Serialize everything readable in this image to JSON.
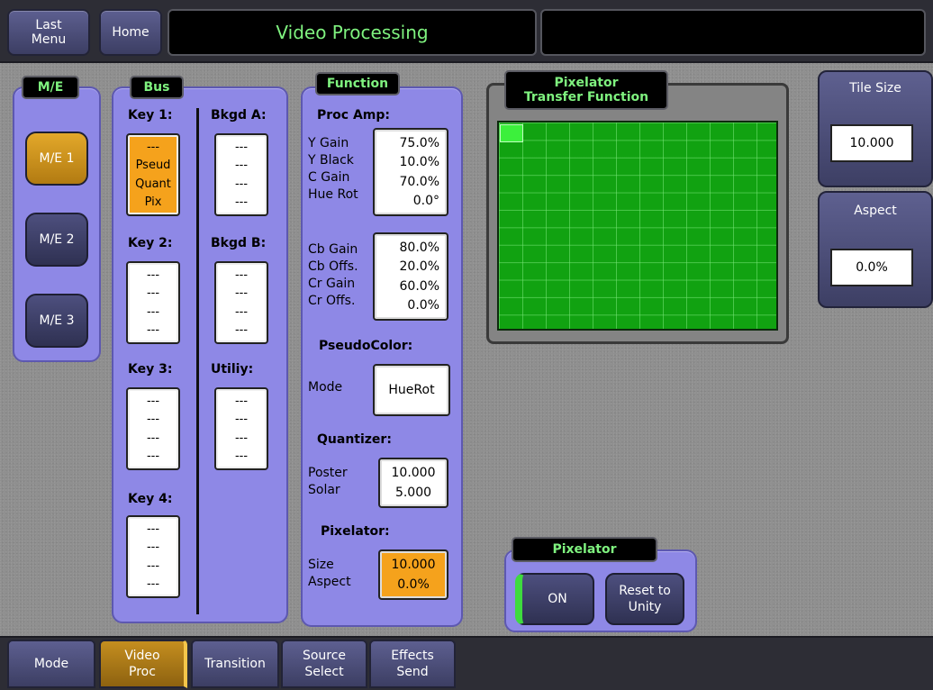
{
  "header": {
    "last_menu": "Last\nMenu",
    "home": "Home",
    "title": "Video Processing",
    "right_box": ""
  },
  "me": {
    "tag": "M/E",
    "buttons": [
      "M/E 1",
      "M/E 2",
      "M/E 3"
    ],
    "active": "M/E 1"
  },
  "bus": {
    "tag": "Bus",
    "key1": {
      "label": "Key 1:",
      "lines": [
        "---",
        "Pseud",
        "Quant",
        "Pix"
      ]
    },
    "key2": {
      "label": "Key 2:",
      "lines": [
        "---",
        "---",
        "---",
        "---"
      ]
    },
    "key3": {
      "label": "Key 3:",
      "lines": [
        "---",
        "---",
        "---",
        "---"
      ]
    },
    "key4": {
      "label": "Key 4:",
      "lines": [
        "---",
        "---",
        "---",
        "---"
      ]
    },
    "bkgd_a": {
      "label": "Bkgd A:",
      "lines": [
        "---",
        "---",
        "---",
        "---"
      ]
    },
    "bkgd_b": {
      "label": "Bkgd B:",
      "lines": [
        "---",
        "---",
        "---",
        "---"
      ]
    },
    "utility": {
      "label": "Utiliy:",
      "lines": [
        "---",
        "---",
        "---",
        "---"
      ]
    }
  },
  "function": {
    "tag": "Function",
    "proc_amp": {
      "heading": "Proc Amp:",
      "labels1": [
        "Y Gain",
        "Y Black",
        "C Gain",
        "Hue Rot"
      ],
      "values1": [
        "75.0%",
        "10.0%",
        "70.0%",
        "0.0°"
      ],
      "labels2": [
        "Cb Gain",
        "Cb Offs.",
        "Cr Gain",
        "Cr Offs."
      ],
      "values2": [
        "80.0%",
        "20.0%",
        "60.0%",
        "0.0%"
      ]
    },
    "pseudocolor": {
      "heading": "PseudoColor:",
      "label": "Mode",
      "value": "HueRot"
    },
    "quantizer": {
      "heading": "Quantizer:",
      "labels": [
        "Poster",
        "Solar"
      ],
      "values": [
        "10.000",
        "5.000"
      ]
    },
    "pixelator": {
      "heading": "Pixelator:",
      "labels": [
        "Size",
        "Aspect"
      ],
      "values": [
        "10.000",
        "0.0%"
      ]
    }
  },
  "transfer": {
    "tag_line1": "Pixelator",
    "tag_line2": "Transfer Function"
  },
  "tile_size": {
    "label": "Tile Size",
    "value": "10.000"
  },
  "aspect": {
    "label": "Aspect",
    "value": "0.0%"
  },
  "pixelator_panel": {
    "tag": "Pixelator",
    "on": "ON",
    "reset_line1": "Reset to",
    "reset_line2": "Unity"
  },
  "tabs": [
    {
      "l1": "Mode",
      "l2": ""
    },
    {
      "l1": "Video",
      "l2": "Proc"
    },
    {
      "l1": "Transition",
      "l2": ""
    },
    {
      "l1": "Source",
      "l2": "Select"
    },
    {
      "l1": "Effects",
      "l2": "Send"
    }
  ],
  "colors": {
    "panel": "#8e88e6",
    "accent_green": "#7ff27f",
    "selected_orange": "#f5a21c",
    "grid_green": "#11a211"
  }
}
